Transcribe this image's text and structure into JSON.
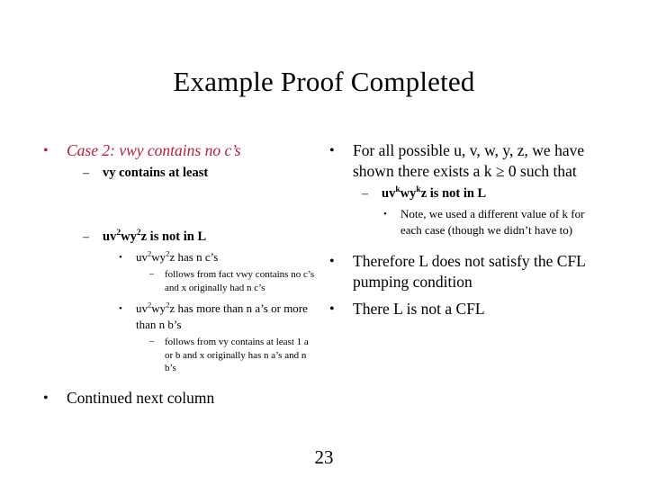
{
  "slide": {
    "title": "Example Proof Completed",
    "page_number": "23",
    "accent_color": "#b0203c",
    "text_color": "#000000",
    "background_color": "#ffffff"
  },
  "markers": {
    "round": "•",
    "dash": "–"
  },
  "left_column": {
    "case_heading": "Case 2: vwy contains no c’s",
    "point_vy": "vy contains at least",
    "point_uv2_prefix": "uv",
    "point_uv2_sup1": "2",
    "point_uv2_mid": "wy",
    "point_uv2_sup2": "2",
    "point_uv2_suffix": "z is not in L",
    "sub_has_n_cs_prefix": "uv",
    "sub_has_n_cs_sup1": "2",
    "sub_has_n_cs_mid": "wy",
    "sub_has_n_cs_sup2": "2",
    "sub_has_n_cs_suffix": "z has n c’s",
    "sub_has_n_cs_reason": "follows from fact vwy contains no c’s and x originally had n c’s",
    "sub_more_than_prefix": "uv",
    "sub_more_than_sup1": "2",
    "sub_more_than_mid": "wy",
    "sub_more_than_sup2": "2",
    "sub_more_than_suffix": "z has more than n a’s or more than n b’s",
    "sub_more_than_reason": "follows from vy contains at least 1 a or b and x originally has n a’s and n b’s",
    "continued": "Continued next column"
  },
  "right_column": {
    "for_all_possible": "For all possible u, v, w, y, z, we have shown there exists a k ≥ 0 such that",
    "uvk_prefix": "uv",
    "uvk_sup1": "k",
    "uvk_mid": "wy",
    "uvk_sup2": "k",
    "uvk_suffix": "z is not in L",
    "note": "Note, we used a different value of k for each case (though we didn’t have to)",
    "therefore": "Therefore L does not satisfy the CFL pumping condition",
    "conclusion": "There L is not a CFL"
  }
}
